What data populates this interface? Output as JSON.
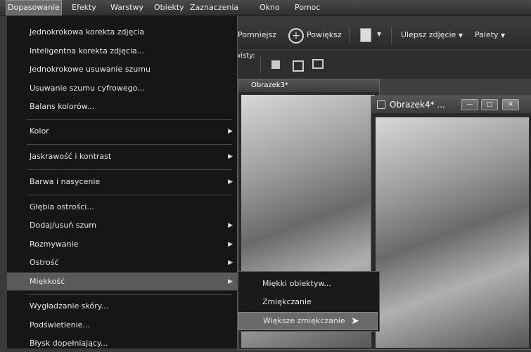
{
  "menubar": {
    "items": [
      "Dopasowanie",
      "Efekty",
      "Warstwy",
      "Obiekty",
      "Zaznaczenia",
      "Okno",
      "Pomoc"
    ]
  },
  "toolbar": {
    "zoom_out": "Pomniejsz",
    "zoom_in": "Powiększ",
    "enhance": "Ulepsz zdjęcie",
    "palettes": "Palety",
    "row2_label": "wisty:"
  },
  "menu": {
    "items": [
      {
        "label": "Jednokrokowa korekta zdjęcia"
      },
      {
        "label": "Inteligentna korekta zdjęcia..."
      },
      {
        "label": "Jednokrokowe usuwanie szumu"
      },
      {
        "label": "Usuwanie szumu cyfrowego..."
      },
      {
        "label": "Balans kolorów..."
      },
      {
        "label": "Kolor"
      },
      {
        "label": "Jaskrawość i kontrast"
      },
      {
        "label": "Barwa i nasycenie"
      },
      {
        "label": "Głębia ostrości..."
      },
      {
        "label": "Dodaj/usuń szum"
      },
      {
        "label": "Rozmywanie"
      },
      {
        "label": "Ostrość"
      },
      {
        "label": "Miękkość"
      },
      {
        "label": "Wygładzanie skóry..."
      },
      {
        "label": "Podświetlenie..."
      },
      {
        "label": "Błysk dopełniający..."
      }
    ]
  },
  "submenu": {
    "items": [
      "Miękki obiektyw...",
      "Zmiękczanie",
      "Większe zmiękczanie"
    ]
  },
  "windows": {
    "back_title": "Obrazek3*",
    "front_title": "Obrazek4* ..."
  }
}
